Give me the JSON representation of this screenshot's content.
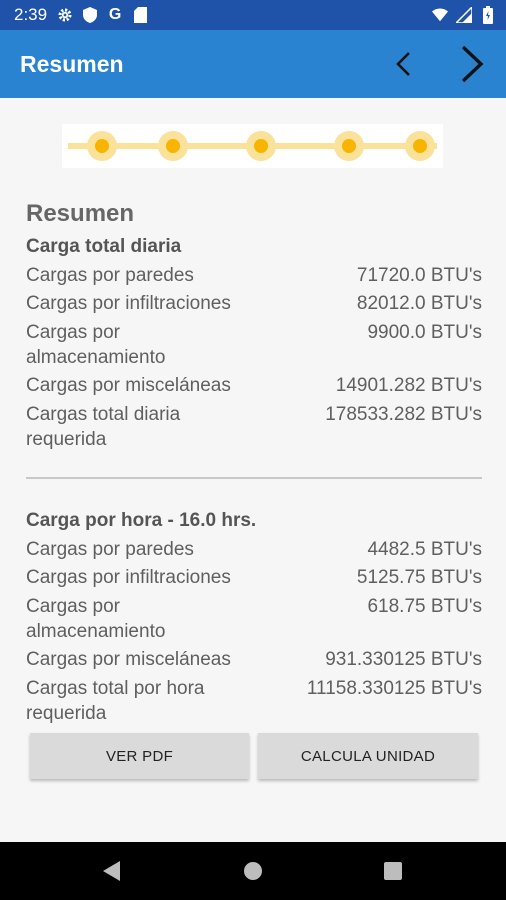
{
  "status_bar": {
    "time": "2:39",
    "icons": [
      "settings-icon",
      "shield-icon",
      "google-icon",
      "sd-card-icon",
      "wifi-icon",
      "signal-icon",
      "battery-icon"
    ],
    "google_letter": "G"
  },
  "app_bar": {
    "title": "Resumen",
    "prev_icon": "chevron-left-icon",
    "next_icon": "chevron-right-icon",
    "color": "#2a83d1"
  },
  "stepper": {
    "steps": 5,
    "color": "#f7b500"
  },
  "main": {
    "heading": "Resumen",
    "daily": {
      "title": "Carga total diaria",
      "rows": [
        {
          "label": "Cargas por paredes",
          "value": "71720.0 BTU's"
        },
        {
          "label": "Cargas por infiltraciones",
          "value": "82012.0 BTU's"
        },
        {
          "label": "Cargas por almacenamiento",
          "value": "9900.0 BTU's"
        },
        {
          "label": "Cargas por misceláneas",
          "value": "14901.282 BTU's"
        },
        {
          "label": "Cargas total diaria requerida",
          "value": "178533.282 BTU's"
        }
      ]
    },
    "hourly": {
      "title": "Carga por hora - 16.0 hrs.",
      "rows": [
        {
          "label": "Cargas por paredes",
          "value": "4482.5 BTU's"
        },
        {
          "label": "Cargas por infiltraciones",
          "value": "5125.75 BTU's"
        },
        {
          "label": "Cargas por almacenamiento",
          "value": "618.75 BTU's"
        },
        {
          "label": "Cargas por misceláneas",
          "value": "931.330125 BTU's"
        },
        {
          "label": "Cargas total por hora requerida",
          "value": "11158.330125 BTU's"
        }
      ]
    }
  },
  "buttons": {
    "pdf_label": "VER PDF",
    "calc_label": "CALCULA UNIDAD"
  },
  "nav_bar": {
    "icons": [
      "back-icon",
      "home-icon",
      "recent-apps-icon"
    ]
  }
}
